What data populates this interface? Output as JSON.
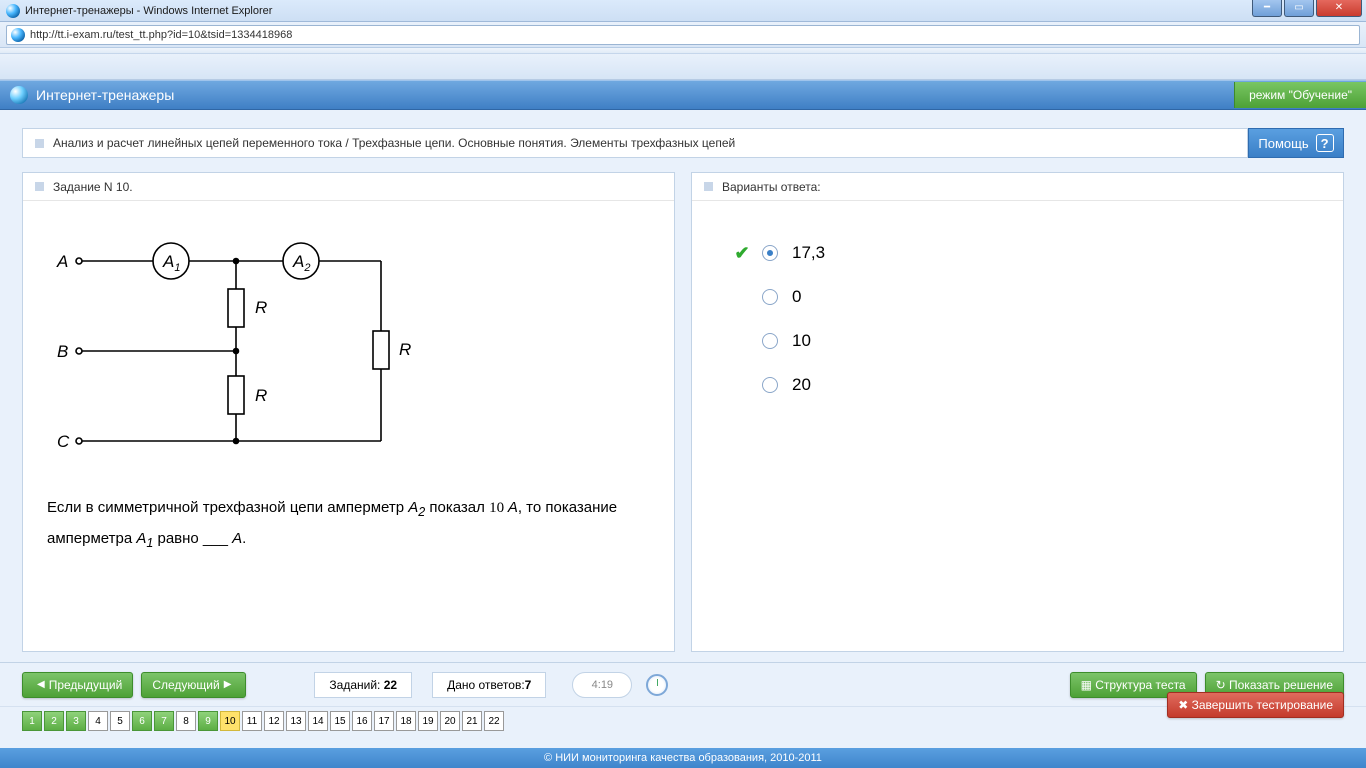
{
  "window": {
    "title": "Интернет-тренажеры - Windows Internet Explorer"
  },
  "address": {
    "url": "http://tt.i-exam.ru/test_tt.php?id=10&tsid=1334418968"
  },
  "app": {
    "title": "Интернет-тренажеры",
    "regime": "режим \"Обучение\""
  },
  "breadcrumb": "Анализ и расчет линейных цепей переменного тока / Трехфазные цепи. Основные понятия. Элементы трехфазных цепей",
  "help": {
    "label": "Помощь",
    "q": "?"
  },
  "task": {
    "header": "Задание N 10.",
    "text_pre": "Если в симметричной трехфазной цепи амперметр ",
    "A2": "A",
    "A2sub": "2",
    "text_mid": " показал ",
    "val": "10 A",
    "text_mid2": ", то показание амперметра ",
    "A1": "A",
    "A1sub": "1",
    "text_post": " равно ___ ",
    "unit": "A",
    "dot": "."
  },
  "circuit": {
    "A": "A",
    "B": "B",
    "C": "C",
    "A1": "A",
    "A1s": "1",
    "A2": "A",
    "A2s": "2",
    "R": "R"
  },
  "answers": {
    "header": "Варианты ответа:",
    "items": [
      {
        "label": "17,3",
        "selected": true,
        "correct": true
      },
      {
        "label": "0",
        "selected": false,
        "correct": false
      },
      {
        "label": "10",
        "selected": false,
        "correct": false
      },
      {
        "label": "20",
        "selected": false,
        "correct": false
      }
    ]
  },
  "nav": {
    "prev": "Предыдущий",
    "next": "Следующий",
    "tasks_label": "Заданий:",
    "tasks_val": "22",
    "answered_label": "Дано ответов:",
    "answered_val": "7",
    "timer": "4:19",
    "structure": "Структура теста",
    "solution": "Показать решение",
    "finish": "Завершить тестирование"
  },
  "pager": {
    "items": [
      "1",
      "2",
      "3",
      "4",
      "5",
      "6",
      "7",
      "8",
      "9",
      "10",
      "11",
      "12",
      "13",
      "14",
      "15",
      "16",
      "17",
      "18",
      "19",
      "20",
      "21",
      "22"
    ],
    "done": [
      1,
      2,
      3,
      6,
      7,
      9
    ],
    "current": 10
  },
  "copyright": "© НИИ мониторинга качества образования, 2010-2011"
}
